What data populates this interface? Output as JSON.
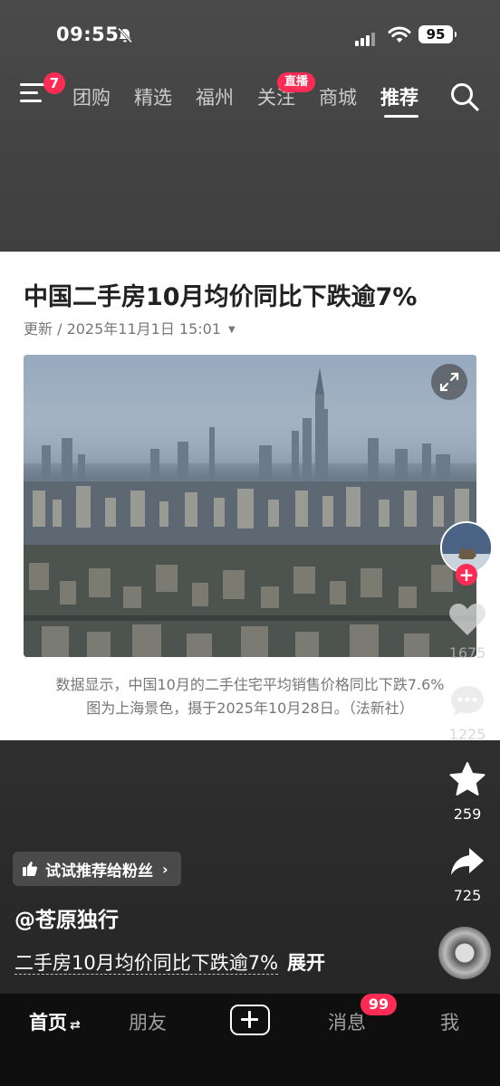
{
  "status_bar": {
    "time": "09:55",
    "battery": "95"
  },
  "top_nav": {
    "menu_badge": "7",
    "tabs": [
      {
        "label": "团购"
      },
      {
        "label": "精选"
      },
      {
        "label": "福州"
      },
      {
        "label": "关注",
        "badge": "直播"
      },
      {
        "label": "商城"
      },
      {
        "label": "推荐",
        "active": true
      }
    ]
  },
  "article": {
    "headline": "中国二手房10月均价同比下跌逾7%",
    "updated": "更新 / 2025年11月1日 15:01",
    "caption_line1": "数据显示，中国10月的二手住宅平均销售价格同比下跌7.6%",
    "caption_line2": "图为上海景色，摄于2025年10月28日。（法新社）"
  },
  "actions": {
    "like_count": "1675",
    "comment_count": "1225",
    "favorite_count": "259",
    "share_count": "725"
  },
  "post": {
    "recommend_label": "试试推荐给粉丝",
    "author": "@苍原独行",
    "description_tag": "二手房10月均价同比下跌逾7%",
    "expand_label": "展开"
  },
  "bottom_nav": {
    "home": "首页",
    "friends": "朋友",
    "messages": "消息",
    "messages_badge": "99",
    "me": "我"
  },
  "colors": {
    "accent": "#fe2c55",
    "card_bg": "#ffffff",
    "bottom_bar": "#0f0f0f"
  }
}
